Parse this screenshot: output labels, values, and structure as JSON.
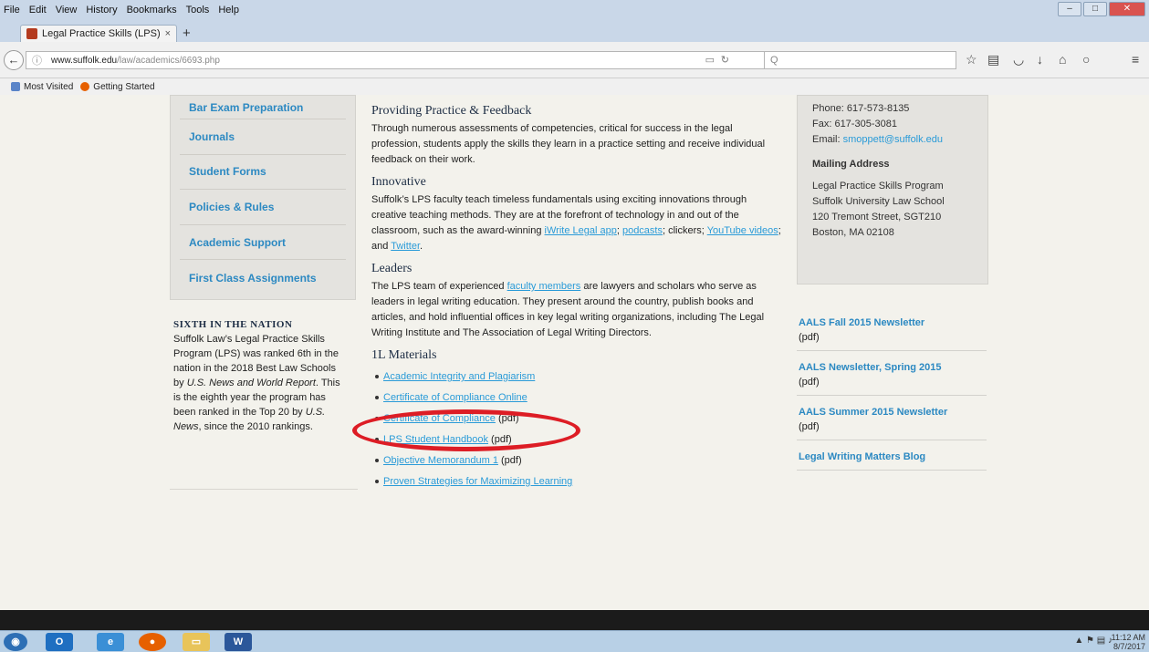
{
  "menu": [
    "File",
    "Edit",
    "View",
    "History",
    "Bookmarks",
    "Tools",
    "Help"
  ],
  "tab": {
    "title": "Legal Practice Skills (LPS) - S",
    "close": "×",
    "new": "+"
  },
  "url": {
    "host": "www.suffolk.edu",
    "path": "/law/academics/6693.php",
    "search_placeholder": "Q"
  },
  "bookmarks": [
    "Most Visited",
    "Getting Started"
  ],
  "sidenav": [
    "Bar Exam Preparation",
    "Journals",
    "Student Forms",
    "Policies & Rules",
    "Academic Support",
    "First Class Assignments"
  ],
  "sixth": {
    "heading": "SIXTH IN THE NATION",
    "p1": "Suffolk Law’s Legal Practice Skills Program (LPS) was ranked 6th in the nation in the 2018 Best Law Schools by ",
    "em1": "U.S. News and World Report",
    "p2": ". This is the eighth year the program has been ranked in the Top 20 by ",
    "em2": "U.S. News",
    "p3": ", since the 2010 rankings."
  },
  "sections": {
    "practice_title": "Providing Practice & Feedback",
    "practice_text": "Through numerous assessments of competencies, critical for success in the legal profession, students apply the skills they learn in a practice setting and receive individual feedback on their work.",
    "innov_title": "Innovative",
    "innov_text_a": "Suffolk’s LPS faculty teach timeless fundamentals using exciting innovations through creative teaching methods. They are at the forefront of technology in and out of the classroom, such as the award-winning ",
    "innov_link1": "iWrite Legal app",
    "innov_sep1": "; ",
    "innov_link2": "podcasts",
    "innov_text_b": "; clickers; ",
    "innov_link3": "YouTube videos",
    "innov_text_c": "; and ",
    "innov_link4": "Twitter",
    "innov_text_d": ".",
    "leaders_title": "Leaders",
    "leaders_text_a": "The LPS team of experienced ",
    "leaders_link": "faculty members",
    "leaders_text_b": " are lawyers and scholars who serve as leaders in legal writing education. They present around the country, publish books and articles, and hold influential offices in key legal writing organizations, including The Legal Writing Institute and The Association of Legal Writing Directors.",
    "materials_title": "1L Materials"
  },
  "materials": [
    {
      "link": "Academic Integrity and Plagiarism",
      "suffix": ""
    },
    {
      "link": "Certificate of Compliance Online",
      "suffix": ""
    },
    {
      "link": "Certificate of Compliance",
      "suffix": " (pdf)"
    },
    {
      "link": "LPS Student Handbook",
      "suffix": " (pdf)"
    },
    {
      "link": "Objective Memorandum 1",
      "suffix": " (pdf)"
    },
    {
      "link": "Proven Strategies for Maximizing Learning",
      "suffix": ""
    }
  ],
  "contact": {
    "phone": "Phone: 617-573-8135",
    "fax": "Fax: 617-305-3081",
    "email_label": "Email: ",
    "email": "smoppett@suffolk.edu",
    "mailing_heading": "Mailing Address",
    "addr1": "Legal Practice Skills Program",
    "addr2": "Suffolk University Law School",
    "addr3": "120 Tremont Street, SGT210",
    "addr4": "Boston, MA 02108"
  },
  "newsletters": [
    {
      "title": "AALS Fall 2015 Newsletter",
      "sub": " (pdf)"
    },
    {
      "title": "AALS Newsletter, Spring 2015",
      "sub": "(pdf)"
    },
    {
      "title": "AALS Summer 2015 Newsletter",
      "sub": "(pdf)"
    },
    {
      "title": "Legal Writing Matters Blog",
      "sub": ""
    }
  ],
  "clock": {
    "time": "11:12 AM",
    "date": "8/7/2017"
  }
}
